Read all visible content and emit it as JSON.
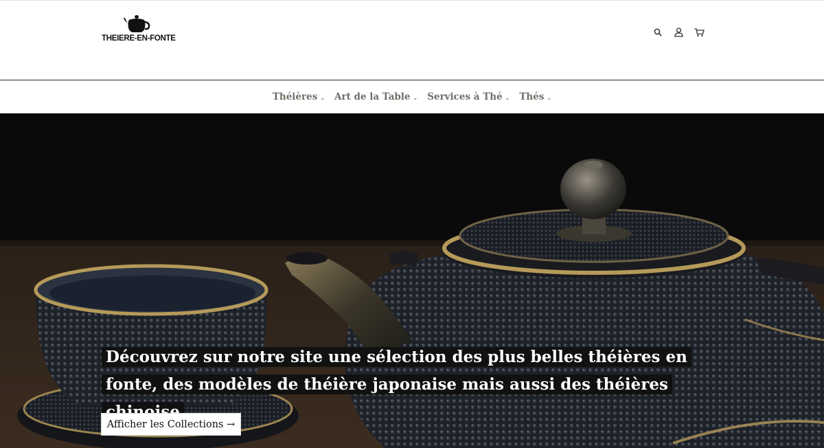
{
  "brand": {
    "logo_text": "THEIERE-EN-FONTE",
    "logo_icon": "teapot-icon"
  },
  "header": {
    "icons": [
      "search-icon",
      "account-icon",
      "cart-icon"
    ]
  },
  "nav": {
    "items": [
      {
        "label": "Théières",
        "has_dropdown": true
      },
      {
        "label": "Art de la Table",
        "has_dropdown": true
      },
      {
        "label": "Services à Thé",
        "has_dropdown": true
      },
      {
        "label": "Thés",
        "has_dropdown": true
      }
    ],
    "dropdown_glyph": "⌄"
  },
  "hero": {
    "title": "Découvrez sur notre site une sélection des plus belles théières en fonte, des modèles de théière japonaise mais aussi des théières chinoise",
    "button_label": "Afficher les Collections →"
  },
  "colors": {
    "nav_text": "#6b7066",
    "hero_caption_bg": "#111111",
    "gold_trim": "#b59a5a"
  }
}
